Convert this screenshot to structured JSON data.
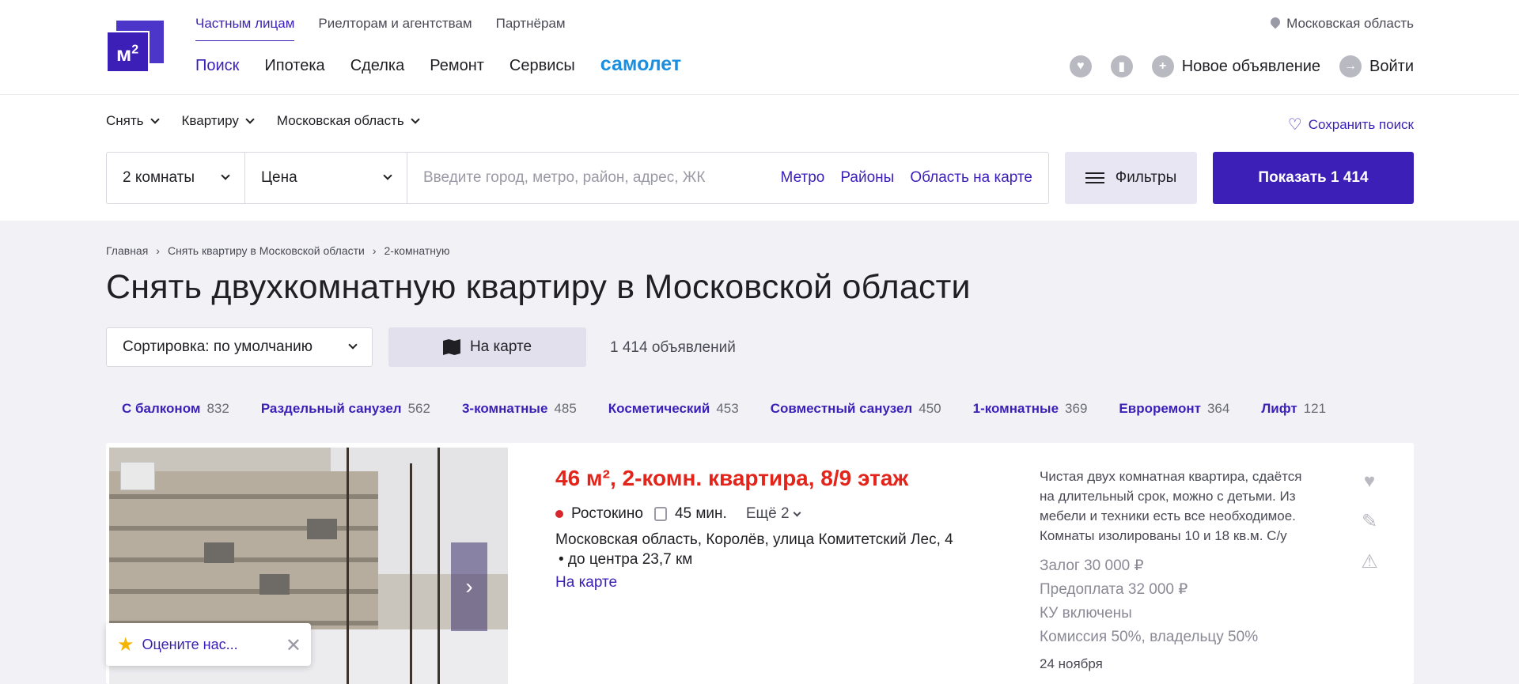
{
  "header": {
    "logo": {
      "text": "м",
      "sup": "2"
    },
    "top_nav": [
      "Частным лицам",
      "Риелторам и агентствам",
      "Партнёрам"
    ],
    "main_nav": [
      "Поиск",
      "Ипотека",
      "Сделка",
      "Ремонт",
      "Сервисы"
    ],
    "brand": "самолет",
    "region": "Московская область",
    "new_ad": "Новое объявление",
    "login": "Войти"
  },
  "search": {
    "deal": "Снять",
    "type": "Квартиру",
    "region": "Московская область",
    "save_search": "Сохранить поиск",
    "rooms": "2 комнаты",
    "price": "Цена",
    "placeholder": "Введите город, метро, район, адрес, ЖК",
    "links": [
      "Метро",
      "Районы",
      "Область на карте"
    ],
    "filters": "Фильтры",
    "show": "Показать 1 414"
  },
  "breadcrumb": [
    "Главная",
    "Снять квартиру в Московской области",
    "2-комнатную"
  ],
  "page_title": "Снять двухкомнатную квартиру в Московской области",
  "sort": {
    "label": "Сортировка: по умолчанию",
    "map": "На карте",
    "count": "1 414 объявлений"
  },
  "chips": [
    {
      "label": "С балконом",
      "count": "832"
    },
    {
      "label": "Раздельный санузел",
      "count": "562"
    },
    {
      "label": "3-комнатные",
      "count": "485"
    },
    {
      "label": "Косметический",
      "count": "453"
    },
    {
      "label": "Совместный санузел",
      "count": "450"
    },
    {
      "label": "1-комнатные",
      "count": "369"
    },
    {
      "label": "Евроремонт",
      "count": "364"
    },
    {
      "label": "Лифт",
      "count": "121"
    }
  ],
  "listing": {
    "title": "46 м², 2-комн. квартира, 8/9 этаж",
    "metro": "Ростокино",
    "travel": "45 мин.",
    "more": "Ещё 2",
    "address": "Московская область, Королёв, улица Комитетский Лес, 4",
    "distance": "• до центра 23,7 км",
    "on_map": "На карте",
    "description": "Чистая двух комнатная квартира, сдаётся на длительный срок, можно с детьми. Из мебели и техники есть все необходимое. Комнаты изолированы 10 и 18 кв.м. С/у",
    "deposit": "Залог 30 000 ₽",
    "prepay": "Предоплата 32 000 ₽",
    "utilities": "КУ включены",
    "commission": "Комиссия 50%, владельцу 50%",
    "date": "24 ноября"
  },
  "toast": {
    "text": "Оцените нас..."
  },
  "colors": {
    "accent": "#3b1fb7",
    "price": "#e3241b",
    "background": "#f2f2f6"
  }
}
